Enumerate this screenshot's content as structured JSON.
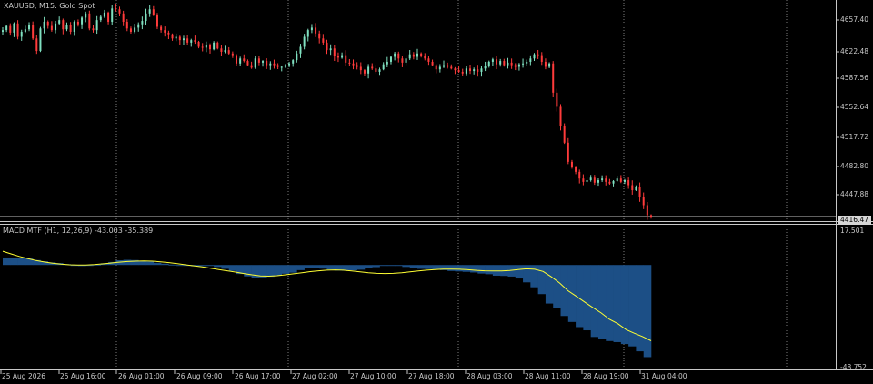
{
  "chart_data": [
    {
      "type": "candlestick",
      "title": "XAUUSD, M15:  Gold Spot",
      "symbol": "XAUUSD",
      "timeframe": "M15",
      "description": "Gold Spot",
      "background": "#000000",
      "colors": {
        "bull": "#7fe0c0",
        "bear": "#ff3b3b",
        "grid": "#9a9a9a",
        "axis": "#c8c8c8"
      },
      "ylim": [
        4412.0,
        4674.0
      ],
      "y_ticks": [
        "4657.40",
        "4622.48",
        "4587.56",
        "4552.64",
        "4517.72",
        "4482.80",
        "4447.88"
      ],
      "current_price": "4416.47",
      "close_series": [
        4640,
        4645,
        4637,
        4648,
        4632,
        4638,
        4641,
        4646,
        4630,
        4615,
        4642,
        4650,
        4645,
        4640,
        4648,
        4652,
        4641,
        4646,
        4638,
        4650,
        4647,
        4655,
        4660,
        4642,
        4640,
        4652,
        4656,
        4661,
        4650,
        4666,
        4665,
        4660,
        4650,
        4642,
        4638,
        4643,
        4647,
        4651,
        4660,
        4665,
        4658,
        4644,
        4640,
        4637,
        4635,
        4630,
        4632,
        4628,
        4630,
        4625,
        4628,
        4626,
        4620,
        4619,
        4622,
        4617,
        4625,
        4618,
        4614,
        4616,
        4612,
        4610,
        4600,
        4606,
        4603,
        4598,
        4595,
        4606,
        4601,
        4603,
        4598,
        4600,
        4598,
        4596,
        4596,
        4598,
        4600,
        4604,
        4612,
        4620,
        4632,
        4640,
        4643,
        4636,
        4630,
        4625,
        4616,
        4618,
        4609,
        4607,
        4610,
        4601,
        4600,
        4598,
        4596,
        4592,
        4588,
        4596,
        4594,
        4590,
        4593,
        4599,
        4602,
        4608,
        4612,
        4606,
        4601,
        4606,
        4611,
        4608,
        4612,
        4609,
        4606,
        4602,
        4598,
        4593,
        4596,
        4598,
        4596,
        4594,
        4592,
        4590,
        4588,
        4594,
        4591,
        4593,
        4590,
        4594,
        4597,
        4602,
        4605,
        4599,
        4603,
        4598,
        4601,
        4598,
        4596,
        4599,
        4600,
        4602,
        4606,
        4611,
        4610,
        4602,
        4596,
        4600,
        4565,
        4548,
        4525,
        4505,
        4482,
        4476,
        4470,
        4462,
        4458,
        4460,
        4463,
        4457,
        4460,
        4462,
        4458,
        4456,
        4459,
        4462,
        4458,
        4460,
        4454,
        4448,
        4452,
        4440,
        4430,
        4418,
        4416.47
      ],
      "time_labels": [
        "25 Aug 2026",
        "25 Aug 16:00",
        "26 Aug 01:00",
        "26 Aug 09:00",
        "26 Aug 17:00",
        "27 Aug 02:00",
        "27 Aug 10:00",
        "27 Aug 18:00",
        "28 Aug 03:00",
        "28 Aug 11:00",
        "28 Aug 19:00",
        "31 Aug 04:00"
      ],
      "grid": "vertical dotted",
      "x_range": [
        "25 Aug 2026",
        "31 Aug 04:00"
      ]
    },
    {
      "type": "histogram+line",
      "title": "MACD MTF (H1, 12,26,9) -43.003 -35.389",
      "indicator": "MACD MTF",
      "params": "H1, 12,26,9",
      "value_main": "-43.003",
      "value_signal": "-35.389",
      "ylim": [
        -48.752,
        17.501
      ],
      "y_ticks": [
        "17.501",
        "-48.752"
      ],
      "colors": {
        "histogram": "#1c4f86",
        "signal": "#ffff33"
      },
      "histogram": [
        3.5,
        3.5,
        3.3,
        3.0,
        2.3,
        1.7,
        1.2,
        0.9,
        0.4,
        -0.2,
        -0.5,
        -0.3,
        0.2,
        0.8,
        1.4,
        2.2,
        2.4,
        2.3,
        1.9,
        1.6,
        1.0,
        0.6,
        0.2,
        0.0,
        -0.4,
        -0.6,
        -0.5,
        -0.3,
        -0.9,
        -1.8,
        -2.8,
        -4.2,
        -5.3,
        -6.2,
        -5.8,
        -5.5,
        -4.8,
        -4.1,
        -3.6,
        -2.4,
        -1.6,
        -1.5,
        -1.7,
        -2.2,
        -2.6,
        -2.7,
        -2.5,
        -2.2,
        -1.6,
        -1.0,
        -0.3,
        0.0,
        -0.1,
        -0.9,
        -1.5,
        -1.8,
        -1.9,
        -2.1,
        -2.4,
        -2.8,
        -3.0,
        -3.2,
        -3.5,
        -4.0,
        -4.3,
        -5.0,
        -5.1,
        -5.4,
        -6.3,
        -8.1,
        -10.4,
        -13.6,
        -18.0,
        -20.3,
        -23.8,
        -26.6,
        -29.0,
        -30.5,
        -33.6,
        -34.4,
        -35.5,
        -36.0,
        -36.9,
        -38.0,
        -40.3,
        -43.003
      ],
      "signal_line": [
        6.4,
        5.2,
        4.0,
        3.0,
        2.1,
        1.4,
        0.8,
        0.4,
        0.1,
        0.0,
        0.0,
        0.2,
        0.5,
        0.9,
        1.3,
        1.6,
        1.8,
        1.9,
        1.8,
        1.5,
        1.1,
        0.6,
        0.1,
        -0.4,
        -0.9,
        -1.5,
        -2.1,
        -2.7,
        -3.3,
        -4.0,
        -4.6,
        -5.1,
        -5.2,
        -5.0,
        -4.6,
        -4.1,
        -3.6,
        -3.1,
        -2.7,
        -2.4,
        -2.3,
        -2.4,
        -2.8,
        -3.2,
        -3.6,
        -3.9,
        -4.0,
        -3.9,
        -3.6,
        -3.2,
        -2.8,
        -2.4,
        -2.1,
        -1.9,
        -1.9,
        -2.0,
        -2.2,
        -2.5,
        -2.7,
        -2.8,
        -2.8,
        -2.6,
        -2.1,
        -1.8,
        -2.0,
        -3.0,
        -5.5,
        -8.4,
        -12.0,
        -14.6,
        -17.3,
        -19.9,
        -22.4,
        -25.4,
        -27.4,
        -30.2,
        -31.9,
        -33.5,
        -35.389
      ],
      "current_signal": "-35.389"
    }
  ]
}
